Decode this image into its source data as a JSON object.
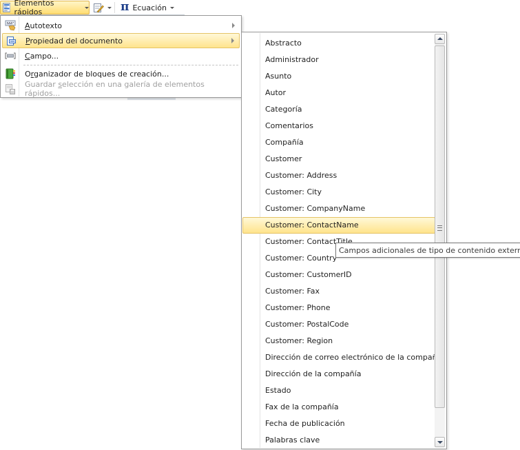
{
  "toolbar": {
    "quick_parts_label": "Elementos rápidos",
    "signature_icon": "signature-line-icon",
    "equation_label": "Ecuación",
    "equation_symbol": "π"
  },
  "quick_parts_menu": {
    "items": [
      {
        "label_pre": "",
        "label_ul": "A",
        "label_post": "utotexto",
        "icon": "autotext-icon",
        "submenu": true,
        "highlighted": false,
        "disabled": false
      },
      {
        "label_pre": "",
        "label_ul": "P",
        "label_post": "ropiedad del documento",
        "icon": "document-property-icon",
        "submenu": true,
        "highlighted": true,
        "disabled": false
      },
      {
        "label_pre": "",
        "label_ul": "C",
        "label_post": "ampo...",
        "icon": "field-icon",
        "submenu": false,
        "highlighted": false,
        "disabled": false
      },
      {
        "label_pre": "O",
        "label_ul": "r",
        "label_post": "ganizador de bloques de creación...",
        "icon": "building-blocks-organizer-icon",
        "submenu": false,
        "highlighted": false,
        "disabled": false
      },
      {
        "label_pre": "Guardar ",
        "label_ul": "s",
        "label_post": "elección en una galería de elementos rápidos...",
        "icon": "save-selection-icon",
        "submenu": false,
        "highlighted": false,
        "disabled": true
      }
    ]
  },
  "document_property_submenu": {
    "items": [
      "Abstracto",
      "Administrador",
      "Asunto",
      "Autor",
      "Categoría",
      "Comentarios",
      "Compañía",
      "Customer",
      "Customer: Address",
      "Customer: City",
      "Customer: CompanyName",
      "Customer: ContactName",
      "Customer: ContactTitle",
      "Customer: Country",
      "Customer: CustomerID",
      "Customer: Fax",
      "Customer: Phone",
      "Customer: PostalCode",
      "Customer: Region",
      "Dirección de correo electrónico de la compañía",
      "Dirección de la compañía",
      "Estado",
      "Fax de la compañía",
      "Fecha de publicación",
      "Palabras clave"
    ],
    "highlighted_index": 11,
    "scroll_position_fraction": 0.0
  },
  "tooltip": {
    "text": "Campos adicionales de tipo de contenido externo"
  }
}
